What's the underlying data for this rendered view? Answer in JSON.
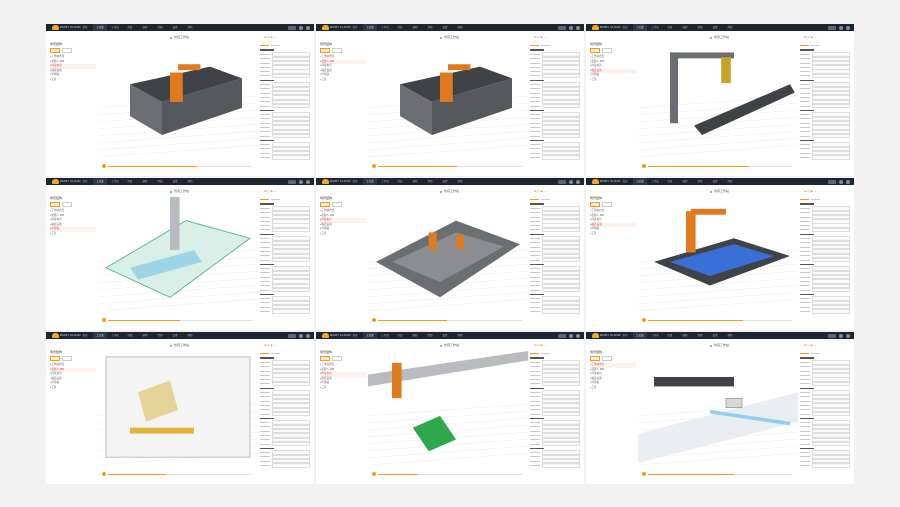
{
  "brand": {
    "logo_text": "RUIRY CLOUD",
    "accent": "#f39c12",
    "nav_bg": "#1d2531"
  },
  "nav_items": [
    "首页",
    "工艺库",
    "工作站",
    "仿真",
    "编程",
    "资源",
    "设置",
    "帮助"
  ],
  "panels": [
    {
      "id": 1,
      "active_nav": 1,
      "crumb": "仿真工作站",
      "viewport_layout": "center",
      "props_side": "right",
      "sidebar_title": "场景结构",
      "tree": [
        "工作站布局",
        "机器人 IRB",
        "焊接夹具",
        "输送设备",
        "外部轴",
        "工具"
      ],
      "selected": 2,
      "progress": 0.62
    },
    {
      "id": 2,
      "active_nav": 1,
      "crumb": "仿真工作站",
      "viewport_layout": "left",
      "props_side": "right",
      "sidebar_title": "场景结构",
      "tree": [
        "工作站布局",
        "机器人 IRB",
        "焊接夹具",
        "输送设备",
        "外部轴",
        "工具"
      ],
      "selected": 1,
      "progress": 0.55
    },
    {
      "id": 3,
      "active_nav": 1,
      "crumb": "仿真工作站",
      "viewport_layout": "right",
      "props_side": "right",
      "sidebar_title": "场景结构",
      "tree": [
        "工作站布局",
        "机器人 IRB",
        "焊接夹具",
        "输送设备",
        "外部轴",
        "工具"
      ],
      "selected": 3,
      "progress": 0.7
    },
    {
      "id": 4,
      "active_nav": 1,
      "crumb": "仿真工作站",
      "viewport_layout": "center",
      "props_side": "right",
      "sidebar_title": "场景结构",
      "tree": [
        "工作站布局",
        "机器人 IRB",
        "焊接夹具",
        "输送设备",
        "外部轴",
        "工具"
      ],
      "selected": 4,
      "progress": 0.5
    },
    {
      "id": 5,
      "active_nav": 1,
      "crumb": "仿真工作站",
      "viewport_layout": "center",
      "props_side": "right",
      "sidebar_title": "场景结构",
      "tree": [
        "工作站布局",
        "机器人 IRB",
        "焊接夹具",
        "输送设备",
        "外部轴",
        "工具"
      ],
      "selected": 2,
      "progress": 0.48
    },
    {
      "id": 6,
      "active_nav": 1,
      "crumb": "仿真工作站",
      "viewport_layout": "right",
      "props_side": "right",
      "sidebar_title": "场景结构",
      "tree": [
        "工作站布局",
        "机器人 IRB",
        "焊接夹具",
        "输送设备",
        "外部轴",
        "工具"
      ],
      "selected": 3,
      "progress": 0.66
    },
    {
      "id": 7,
      "active_nav": 1,
      "crumb": "仿真工作站",
      "viewport_layout": "center",
      "props_side": "right",
      "sidebar_title": "场景结构",
      "tree": [
        "工作站布局",
        "机器人 IRB",
        "焊接夹具",
        "输送设备",
        "外部轴",
        "工具"
      ],
      "selected": 1,
      "progress": 0.4
    },
    {
      "id": 8,
      "active_nav": 1,
      "crumb": "仿真工作站",
      "viewport_layout": "left",
      "props_side": "right",
      "sidebar_title": "场景结构",
      "tree": [
        "工作站布局",
        "机器人 IRB",
        "焊接夹具",
        "输送设备",
        "外部轴",
        "工具"
      ],
      "selected": 2,
      "progress": 0.28
    },
    {
      "id": 9,
      "active_nav": 1,
      "crumb": "仿真工作站",
      "viewport_layout": "right",
      "props_side": "right",
      "sidebar_title": "场景结构",
      "tree": [
        "工作站布局",
        "机器人 IRB",
        "焊接夹具",
        "输送设备",
        "外部轴",
        "工具"
      ],
      "selected": 0,
      "progress": 0.6
    }
  ]
}
